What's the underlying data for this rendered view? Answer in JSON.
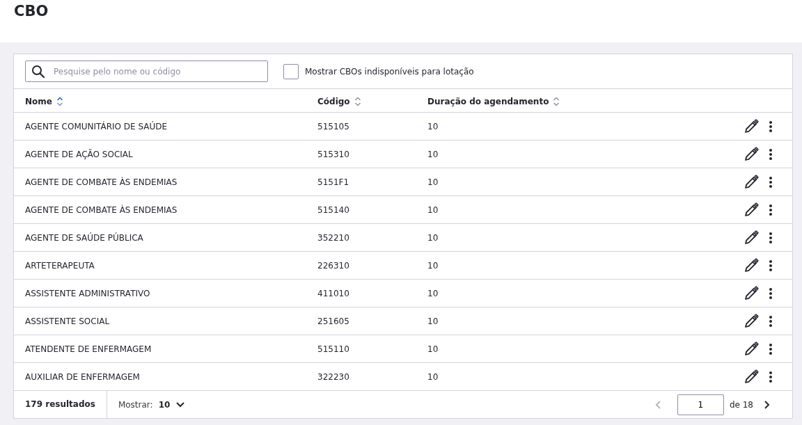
{
  "page": {
    "title": "CBO"
  },
  "search": {
    "placeholder": "Pesquise pelo nome ou código"
  },
  "filter": {
    "label": "Mostrar CBOs indisponíveis para lotação",
    "checked": false
  },
  "table": {
    "columns": [
      {
        "label": "Nome",
        "sorted": true
      },
      {
        "label": "Código",
        "sorted": false
      },
      {
        "label": "Duração do agendamento",
        "sorted": false
      }
    ],
    "rows": [
      {
        "nome": "AGENTE COMUNITÁRIO DE SAÚDE",
        "codigo": "515105",
        "duracao": "10"
      },
      {
        "nome": "AGENTE DE AÇÃO SOCIAL",
        "codigo": "515310",
        "duracao": "10"
      },
      {
        "nome": "AGENTE DE COMBATE ÀS ENDEMIAS",
        "codigo": "5151F1",
        "duracao": "10"
      },
      {
        "nome": "AGENTE DE COMBATE ÀS ENDEMIAS",
        "codigo": "515140",
        "duracao": "10"
      },
      {
        "nome": "AGENTE DE SAÚDE PÚBLICA",
        "codigo": "352210",
        "duracao": "10"
      },
      {
        "nome": "ARTETERAPEUTA",
        "codigo": "226310",
        "duracao": "10"
      },
      {
        "nome": "ASSISTENTE ADMINISTRATIVO",
        "codigo": "411010",
        "duracao": "10"
      },
      {
        "nome": "ASSISTENTE SOCIAL",
        "codigo": "251605",
        "duracao": "10"
      },
      {
        "nome": "ATENDENTE DE ENFERMAGEM",
        "codigo": "515110",
        "duracao": "10"
      },
      {
        "nome": "AUXILIAR DE ENFERMAGEM",
        "codigo": "322230",
        "duracao": "10"
      }
    ]
  },
  "footer": {
    "results": "179 resultados",
    "show_label": "Mostrar:",
    "page_size": "10",
    "page": "1",
    "of_pages": "de 18",
    "prev_disabled": true,
    "next_disabled": false
  }
}
